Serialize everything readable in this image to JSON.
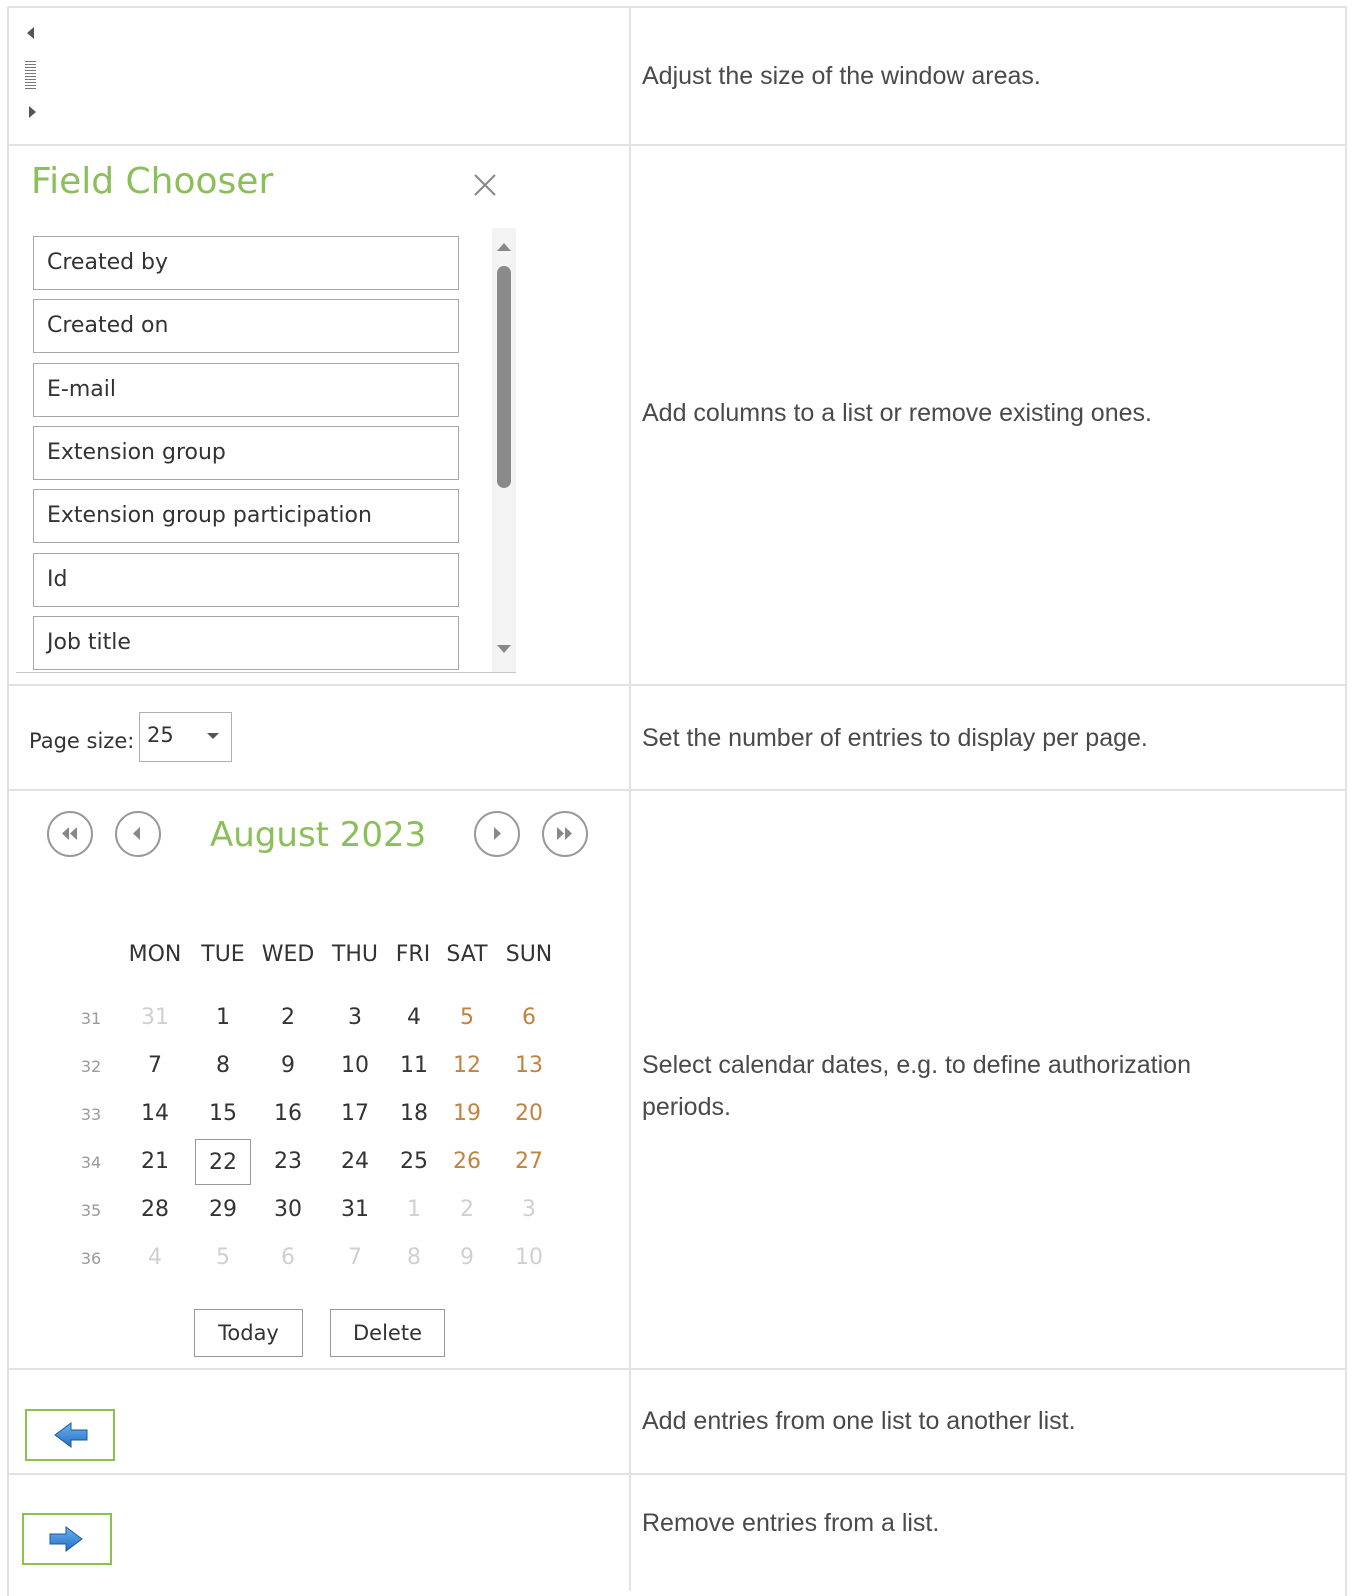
{
  "rows": [
    {
      "description": "Adjust the size of the window areas."
    },
    {
      "description": "Add columns to a list or remove existing ones."
    },
    {
      "description": "Set the number of entries to display per page."
    },
    {
      "description_line1": "Select calendar dates, e.g. to define authorization",
      "description_line2": "periods."
    },
    {
      "description": "Add entries from one list to another list."
    },
    {
      "description": "Remove entries from a list."
    }
  ],
  "splitter": {
    "left_icon": "caret-left-icon",
    "grip_icon": "grip-lines-icon",
    "right_icon": "caret-right-icon"
  },
  "field_chooser": {
    "title": "Field Chooser",
    "close_icon": "close-icon",
    "items": [
      "Created by",
      "Created on",
      "E-mail",
      "Extension group",
      "Extension group participation",
      "Id",
      "Job title"
    ]
  },
  "page_size": {
    "label": "Page size:",
    "value": "25"
  },
  "calendar": {
    "title": "August 2023",
    "nav_icons": [
      "double-chevron-left-icon",
      "chevron-left-icon",
      "chevron-right-icon",
      "double-chevron-right-icon"
    ],
    "weekdays": [
      "MON",
      "TUE",
      "WED",
      "THU",
      "FRI",
      "SAT",
      "SUN"
    ],
    "weeks": [
      {
        "num": "31",
        "days": [
          "31",
          "1",
          "2",
          "3",
          "4",
          "5",
          "6"
        ]
      },
      {
        "num": "32",
        "days": [
          "7",
          "8",
          "9",
          "10",
          "11",
          "12",
          "13"
        ]
      },
      {
        "num": "33",
        "days": [
          "14",
          "15",
          "16",
          "17",
          "18",
          "19",
          "20"
        ]
      },
      {
        "num": "34",
        "days": [
          "21",
          "22",
          "23",
          "24",
          "25",
          "26",
          "27"
        ]
      },
      {
        "num": "35",
        "days": [
          "28",
          "29",
          "30",
          "31",
          "1",
          "2",
          "3"
        ]
      },
      {
        "num": "36",
        "days": [
          "4",
          "5",
          "6",
          "7",
          "8",
          "9",
          "10"
        ]
      }
    ],
    "selected_day": "22",
    "today_label": "Today",
    "delete_label": "Delete"
  },
  "colors": {
    "accent_green": "#8bbf5a",
    "weekend": "#c0843f",
    "arrow_blue": "#2f7fd1",
    "button_border": "#8bc34a"
  },
  "add_button_icon": "arrow-left-icon",
  "remove_button_icon": "arrow-right-icon"
}
